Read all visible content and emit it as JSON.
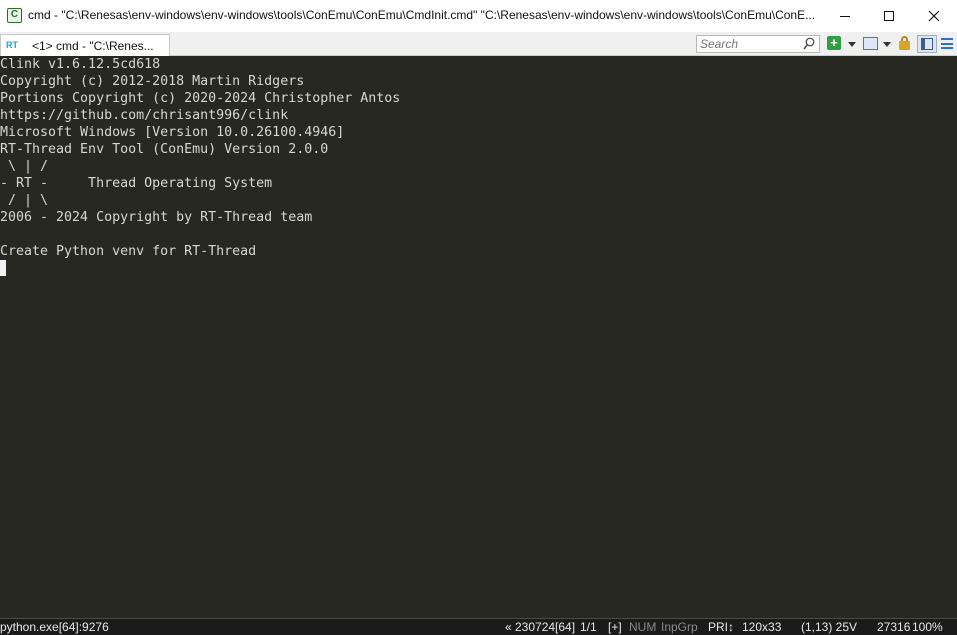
{
  "window": {
    "title": "cmd - \"C:\\Renesas\\env-windows\\env-windows\\tools\\ConEmu\\ConEmu\\CmdInit.cmd\"  \"C:\\Renesas\\env-windows\\env-windows\\tools\\ConEmu\\ConE...",
    "app_icon_glyph": "C"
  },
  "tabbar": {
    "tab_label": "<1> cmd - \"C:\\Renes...",
    "tab_icon_text": "RT",
    "search_placeholder": "Search",
    "add_glyph": "+"
  },
  "console": {
    "lines": [
      "Clink v1.6.12.5cd618",
      "Copyright (c) 2012-2018 Martin Ridgers",
      "Portions Copyright (c) 2020-2024 Christopher Antos",
      "https://github.com/chrisant996/clink",
      "Microsoft Windows [Version 10.0.26100.4946]",
      "RT-Thread Env Tool (ConEmu) Version 2.0.0",
      " \\ | /",
      "- RT -     Thread Operating System",
      " / | \\",
      "2006 - 2024 Copyright by RT-Thread team",
      "",
      "Create Python venv for RT-Thread"
    ]
  },
  "statusbar": {
    "process": "python.exe[64]:9276",
    "pid_info": "« 230724[64]",
    "console_index": "1/1",
    "plus": "[+]",
    "num": "NUM",
    "inpgrp": "InpGrp",
    "priority": "PRI↕",
    "size": "120x33",
    "cursor_pos": "(1,13) 25V",
    "pid2": "27316",
    "zoom": "100%"
  },
  "colors": {
    "console_bg": "#272822",
    "console_fg": "#d7d7d0",
    "statusbar_bg": "#1b1b1b",
    "accent_green": "#2ea043"
  }
}
